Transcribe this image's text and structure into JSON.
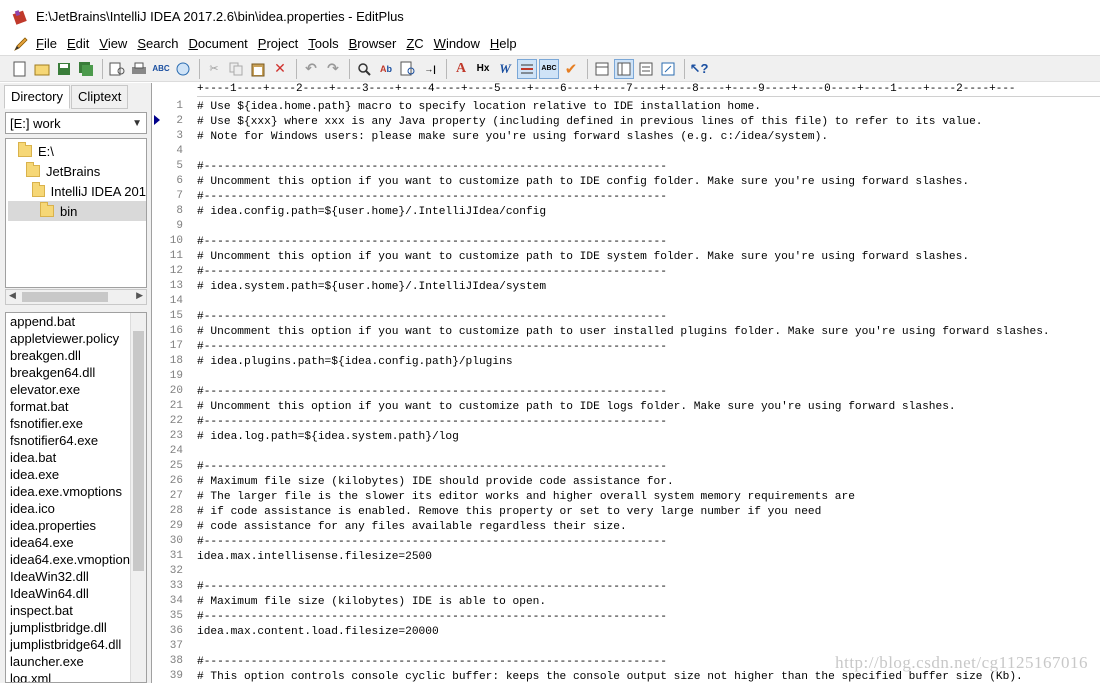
{
  "window": {
    "title": "E:\\JetBrains\\IntelliJ IDEA 2017.2.6\\bin\\idea.properties - EditPlus"
  },
  "menu": {
    "items": [
      {
        "key": "F",
        "rest": "ile"
      },
      {
        "key": "E",
        "rest": "dit"
      },
      {
        "key": "V",
        "rest": "iew"
      },
      {
        "key": "S",
        "rest": "earch"
      },
      {
        "key": "D",
        "rest": "ocument"
      },
      {
        "key": "P",
        "rest": "roject"
      },
      {
        "key": "T",
        "rest": "ools"
      },
      {
        "key": "B",
        "rest": "rowser"
      },
      {
        "key": "Z",
        "rest": "C"
      },
      {
        "key": "W",
        "rest": "indow"
      },
      {
        "key": "H",
        "rest": "elp"
      }
    ]
  },
  "sidebar": {
    "tabs": [
      "Directory",
      "Cliptext"
    ],
    "drive": "[E:] work",
    "tree": [
      "E:\\",
      "JetBrains",
      "IntelliJ IDEA 201",
      "bin"
    ],
    "files": [
      "append.bat",
      "appletviewer.policy",
      "breakgen.dll",
      "breakgen64.dll",
      "elevator.exe",
      "format.bat",
      "fsnotifier.exe",
      "fsnotifier64.exe",
      "idea.bat",
      "idea.exe",
      "idea.exe.vmoptions",
      "idea.ico",
      "idea.properties",
      "idea64.exe",
      "idea64.exe.vmoption",
      "IdeaWin32.dll",
      "IdeaWin64.dll",
      "inspect.bat",
      "jumplistbridge.dll",
      "jumplistbridge64.dll",
      "launcher.exe",
      "log.xml"
    ]
  },
  "editor": {
    "ruler": "+----1----+----2----+----3----+----4----+----5----+----6----+----7----+----8----+----9----+----0----+----1----+----2----+---",
    "lines": [
      "# Use ${idea.home.path} macro to specify location relative to IDE installation home.",
      "# Use ${xxx} where xxx is any Java property (including defined in previous lines of this file) to refer to its value.",
      "# Note for Windows users: please make sure you're using forward slashes (e.g. c:/idea/system).",
      "",
      "#---------------------------------------------------------------------",
      "# Uncomment this option if you want to customize path to IDE config folder. Make sure you're using forward slashes.",
      "#---------------------------------------------------------------------",
      "# idea.config.path=${user.home}/.IntelliJIdea/config",
      "",
      "#---------------------------------------------------------------------",
      "# Uncomment this option if you want to customize path to IDE system folder. Make sure you're using forward slashes.",
      "#---------------------------------------------------------------------",
      "# idea.system.path=${user.home}/.IntelliJIdea/system",
      "",
      "#---------------------------------------------------------------------",
      "# Uncomment this option if you want to customize path to user installed plugins folder. Make sure you're using forward slashes.",
      "#---------------------------------------------------------------------",
      "# idea.plugins.path=${idea.config.path}/plugins",
      "",
      "#---------------------------------------------------------------------",
      "# Uncomment this option if you want to customize path to IDE logs folder. Make sure you're using forward slashes.",
      "#---------------------------------------------------------------------",
      "# idea.log.path=${idea.system.path}/log",
      "",
      "#---------------------------------------------------------------------",
      "# Maximum file size (kilobytes) IDE should provide code assistance for.",
      "# The larger file is the slower its editor works and higher overall system memory requirements are",
      "# if code assistance is enabled. Remove this property or set to very large number if you need",
      "# code assistance for any files available regardless their size.",
      "#---------------------------------------------------------------------",
      "idea.max.intellisense.filesize=2500",
      "",
      "#---------------------------------------------------------------------",
      "# Maximum file size (kilobytes) IDE is able to open.",
      "#---------------------------------------------------------------------",
      "idea.max.content.load.filesize=20000",
      "",
      "#---------------------------------------------------------------------",
      "# This option controls console cyclic buffer: keeps the console output size not higher than the specified buffer size (Kb)."
    ]
  },
  "watermark": "http://blog.csdn.net/cg1125167016",
  "colors": {
    "toolbar_bg": "#f0f0f0",
    "line_number": "#808080",
    "caret": "#00008b"
  }
}
